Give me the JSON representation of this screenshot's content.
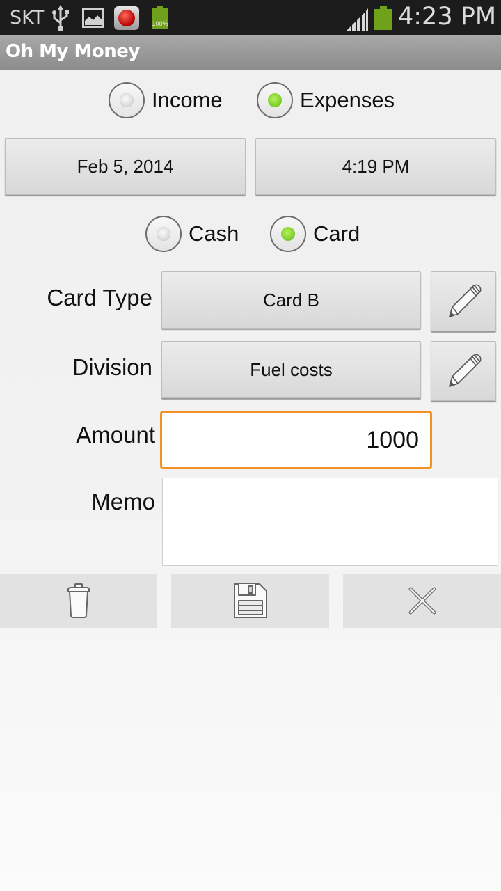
{
  "status_bar": {
    "carrier": "SKT",
    "battery_percent_small": "100%",
    "time": "4:23 PM",
    "icons": [
      "usb-icon",
      "gallery-icon",
      "record-icon",
      "battery-icon",
      "signal-icon",
      "battery-icon"
    ]
  },
  "app": {
    "title": "Oh My Money"
  },
  "form": {
    "type_group": {
      "options": [
        {
          "label": "Income",
          "selected": false
        },
        {
          "label": "Expenses",
          "selected": true
        }
      ]
    },
    "date_button": "Feb 5, 2014",
    "time_button": "4:19 PM",
    "payment_group": {
      "options": [
        {
          "label": "Cash",
          "selected": false
        },
        {
          "label": "Card",
          "selected": true
        }
      ]
    },
    "card_type": {
      "label": "Card Type",
      "value": "Card B",
      "edit_icon": "pencil-icon"
    },
    "division": {
      "label": "Division",
      "value": "Fuel costs",
      "edit_icon": "pencil-icon"
    },
    "amount": {
      "label": "Amount",
      "value": "1000"
    },
    "memo": {
      "label": "Memo",
      "value": ""
    }
  },
  "toolbar": {
    "buttons": [
      {
        "name": "delete",
        "icon": "trash-icon"
      },
      {
        "name": "save",
        "icon": "floppy-disk-icon"
      },
      {
        "name": "cancel",
        "icon": "close-icon"
      }
    ]
  },
  "colors": {
    "accent_focus": "#f39222",
    "radio_selected": "#7ed321",
    "battery": "#6fa21a"
  }
}
